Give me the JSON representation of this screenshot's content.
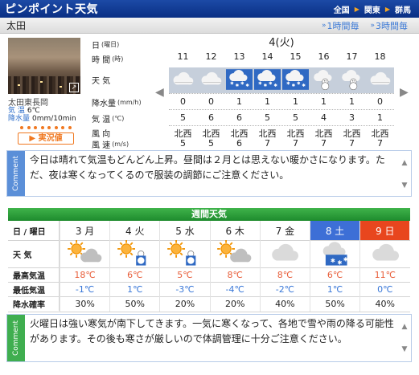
{
  "header": {
    "title": "ピンポイント天気",
    "nav": [
      "全国",
      "関東",
      "群馬"
    ]
  },
  "location": {
    "name": "太田",
    "link_1h": "1時間毎",
    "link_3h": "3時間毎"
  },
  "camera": {
    "name": "太田東長岡",
    "temp_label": "気 温",
    "temp_value": "6℃",
    "precip_label": "降水量",
    "precip_value": "0mm/10min",
    "live_label": "実況値"
  },
  "hourly": {
    "row_labels": [
      {
        "label": "日",
        "unit": "(曜日)"
      },
      {
        "label": "時 間",
        "unit": "(時)"
      },
      {
        "label": "天 気",
        "unit": ""
      },
      {
        "label": "降水量",
        "unit": "(mm/h)"
      },
      {
        "label": "気 温",
        "unit": "(℃)"
      },
      {
        "label": "風 向",
        "unit": ""
      },
      {
        "label": "風 速",
        "unit": "(m/s)"
      }
    ],
    "day": "4(火)",
    "hours": [
      "11",
      "12",
      "13",
      "14",
      "15",
      "16",
      "17",
      "18"
    ],
    "weather_icons": [
      "cloud-icon",
      "cloud-icon",
      "snow-icon",
      "snow-icon",
      "snow-icon",
      "snowman-icon",
      "snowman-icon",
      "cloud-icon"
    ],
    "precip": [
      "0",
      "0",
      "1",
      "1",
      "1",
      "1",
      "1",
      "0"
    ],
    "temp": [
      "5",
      "6",
      "6",
      "5",
      "5",
      "4",
      "3",
      "1"
    ],
    "wind_dir": [
      "北西",
      "北西",
      "北西",
      "北西",
      "北西",
      "北西",
      "北西",
      "北西"
    ],
    "wind_speed": [
      "5",
      "5",
      "6",
      "7",
      "7",
      "7",
      "7",
      "7"
    ]
  },
  "comment_1": {
    "tab": "Comment",
    "text": "今日は晴れて気温もどんどん上昇。昼間は２月とは思えない暖かさになります。ただ、夜は寒くなってくるので服装の調節にご注意ください。"
  },
  "weekly": {
    "title": "週間天気",
    "date_label": "日 / 曜日",
    "weather_label": "天 気",
    "max_label": "最高気温",
    "min_label": "最低気温",
    "rain_label": "降水確率",
    "days": [
      {
        "date": "3 月",
        "icon": "sun-cloud-icon",
        "max": "18℃",
        "min": "-1℃",
        "rain": "30%",
        "style": "normal"
      },
      {
        "date": "4 火",
        "icon": "sun-snow-icon",
        "max": "6℃",
        "min": "1℃",
        "rain": "50%",
        "style": "normal"
      },
      {
        "date": "5 水",
        "icon": "sun-snow-icon",
        "max": "5℃",
        "min": "-3℃",
        "rain": "20%",
        "style": "normal"
      },
      {
        "date": "6 木",
        "icon": "sun-cloud-icon",
        "max": "8℃",
        "min": "-4℃",
        "rain": "20%",
        "style": "normal"
      },
      {
        "date": "7 金",
        "icon": "cloud-icon",
        "max": "8℃",
        "min": "-2℃",
        "rain": "40%",
        "style": "normal"
      },
      {
        "date": "8 土",
        "icon": "cloud-snow-icon",
        "max": "6℃",
        "min": "1℃",
        "rain": "50%",
        "style": "saturday"
      },
      {
        "date": "9 日",
        "icon": "cloud-icon",
        "max": "11℃",
        "min": "0℃",
        "rain": "40%",
        "style": "sunday"
      }
    ]
  },
  "comment_2": {
    "tab": "Comment",
    "text": "火曜日は強い寒気が南下してきます。一気に寒くなって、各地で雪や雨の降る可能性があります。その後も寒さが厳しいので体調管理に十分ご注意ください。"
  },
  "colors": {
    "header_blue": "#0a2f84",
    "week_green": "#1e8b2d",
    "saturday_blue": "#3d6fd6",
    "sunday_red": "#e8461e",
    "hot": "#e85e3a",
    "cold": "#3a78d8"
  }
}
